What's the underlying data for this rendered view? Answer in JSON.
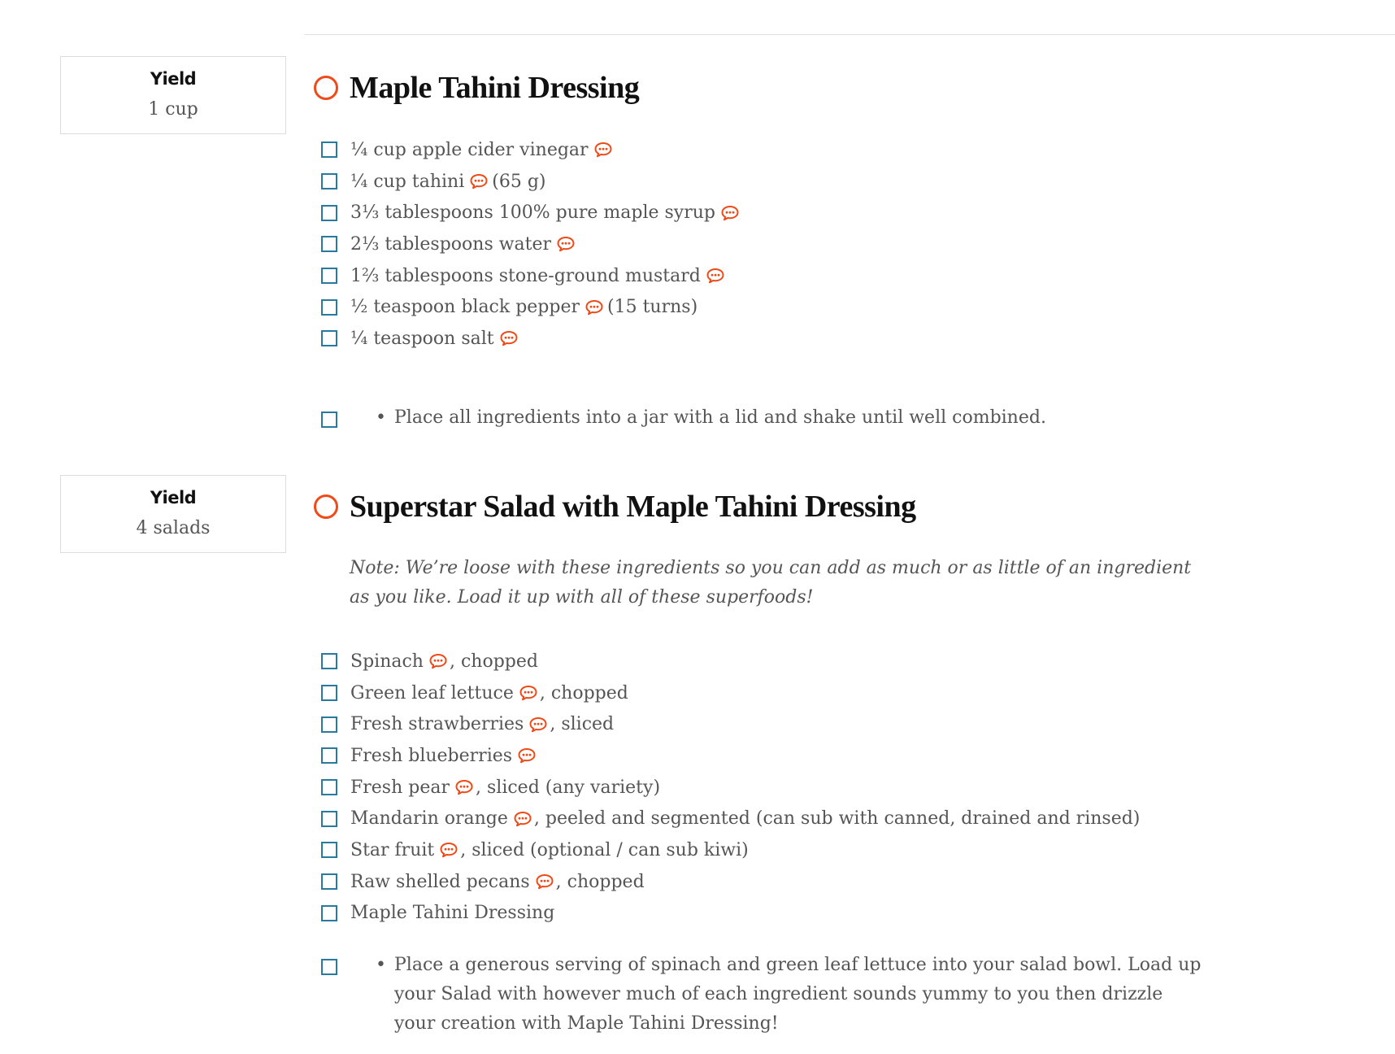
{
  "recipes": [
    {
      "yield_label": "Yield",
      "yield_value": "1 cup",
      "title": "Maple Tahini Dressing",
      "ingredients": [
        {
          "before": "¼ cup apple cider vinegar",
          "after": ""
        },
        {
          "before": "¼ cup tahini",
          "after": "(65 g)"
        },
        {
          "before": "3⅓ tablespoons 100% pure maple syrup",
          "after": ""
        },
        {
          "before": "2⅓ tablespoons water",
          "after": ""
        },
        {
          "before": "1⅔ tablespoons stone-ground mustard",
          "after": ""
        },
        {
          "before": "½ teaspoon black pepper",
          "after": "(15 turns)"
        },
        {
          "before": "¼ teaspoon salt",
          "after": ""
        }
      ],
      "steps": [
        "Place all ingredients into a jar with a lid and shake until well combined."
      ]
    },
    {
      "yield_label": "Yield",
      "yield_value": "4 salads",
      "title": "Superstar Salad with Maple Tahini Dressing",
      "note": "Note: We’re loose with these ingredients so you can add as much or as little of an ingredient as you like. Load it up with all of these superfoods!",
      "ingredients": [
        {
          "before": "Spinach",
          "after": ", chopped"
        },
        {
          "before": "Green leaf lettuce",
          "after": ", chopped"
        },
        {
          "before": "Fresh strawberries",
          "after": ", sliced"
        },
        {
          "before": "Fresh blueberries",
          "after": ""
        },
        {
          "before": "Fresh pear",
          "after": ", sliced (any variety)"
        },
        {
          "before": "Mandarin orange",
          "after": ", peeled and segmented (can sub with canned, drained and rinsed)"
        },
        {
          "before": "Star fruit",
          "after": ", sliced (optional / can sub kiwi)"
        },
        {
          "before": "Raw shelled pecans",
          "after": ", chopped"
        },
        {
          "before": "Maple Tahini Dressing",
          "after": ""
        }
      ],
      "steps": [
        "Place a generous serving of spinach and green leaf lettuce into your salad bowl. Load up your Salad with however much of each ingredient sounds yummy to you then drizzle your creation with Maple Tahini Dressing!"
      ]
    }
  ],
  "icons": {
    "comment": "comment-bubble-icon",
    "title_marker": "circle-outline-icon",
    "checkbox": "checkbox-icon"
  },
  "colors": {
    "accent_orange": "#ef4a18",
    "checkbox_teal": "#287aa0",
    "title_text": "#111111",
    "body_text": "#555555",
    "border": "#dcdcdc"
  }
}
